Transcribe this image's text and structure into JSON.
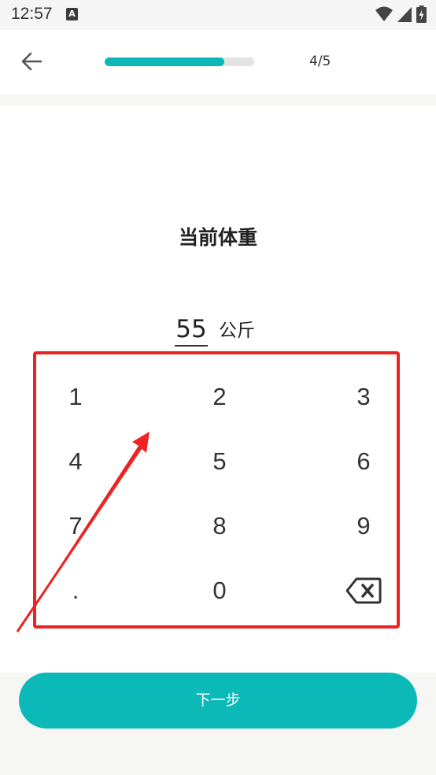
{
  "status_bar": {
    "time": "12:57",
    "notification_icon_letter": "A",
    "icons": [
      "wifi-icon",
      "signal-icon",
      "battery-charging-icon"
    ]
  },
  "header": {
    "back_icon": "arrow-left-icon",
    "progress_fraction": 0.8,
    "step_count": "4/5",
    "accent_color": "#0bb7b7"
  },
  "main": {
    "title": "当前体重",
    "weight_value": "55",
    "weight_unit": "公斤"
  },
  "keypad": {
    "keys": [
      "1",
      "2",
      "3",
      "4",
      "5",
      "6",
      "7",
      "8",
      "9",
      ".",
      "0"
    ],
    "backspace_icon": "backspace-icon",
    "highlight_color": "#ee2222"
  },
  "footer": {
    "next_label": "下一步",
    "button_color": "#0bb9b9"
  }
}
